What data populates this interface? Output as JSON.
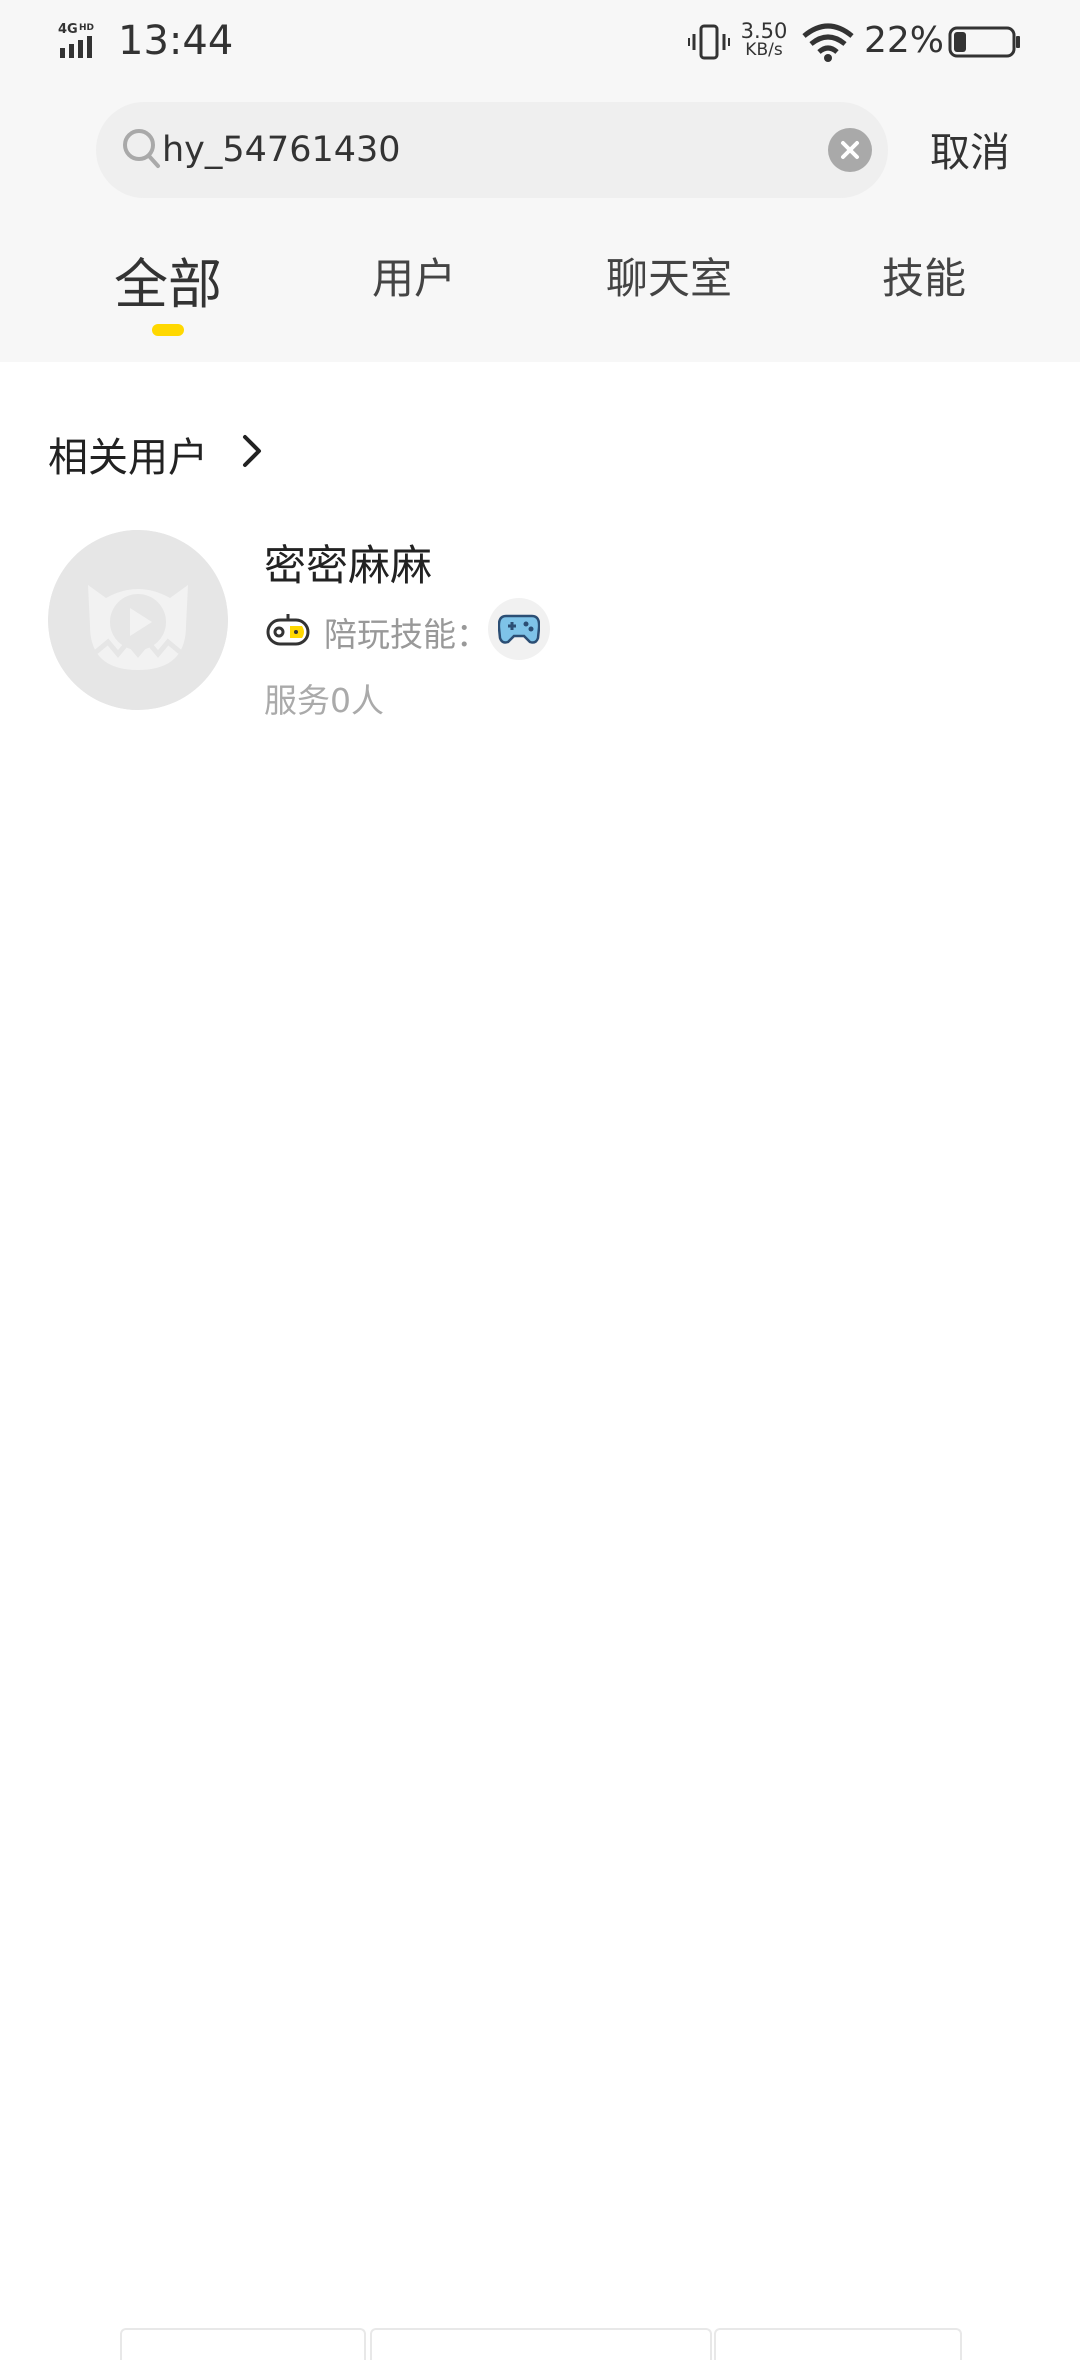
{
  "status_bar": {
    "network": "4G HD",
    "time": "13:44",
    "speed_value": "3.50",
    "speed_unit": "KB/s",
    "battery_percent": "22%",
    "battery_level": 0.22
  },
  "search": {
    "query": "hy_54761430",
    "cancel_label": "取消"
  },
  "tabs": [
    {
      "label": "全部",
      "active": true
    },
    {
      "label": "用户",
      "active": false
    },
    {
      "label": "聊天室",
      "active": false
    },
    {
      "label": "技能",
      "active": false
    }
  ],
  "section": {
    "title": "相关用户"
  },
  "user": {
    "name": "密密麻麻",
    "skill_label": "陪玩技能：",
    "serve_count": "服务0人"
  },
  "colors": {
    "accent": "#ffd800",
    "header_bg": "#f7f7f7"
  }
}
